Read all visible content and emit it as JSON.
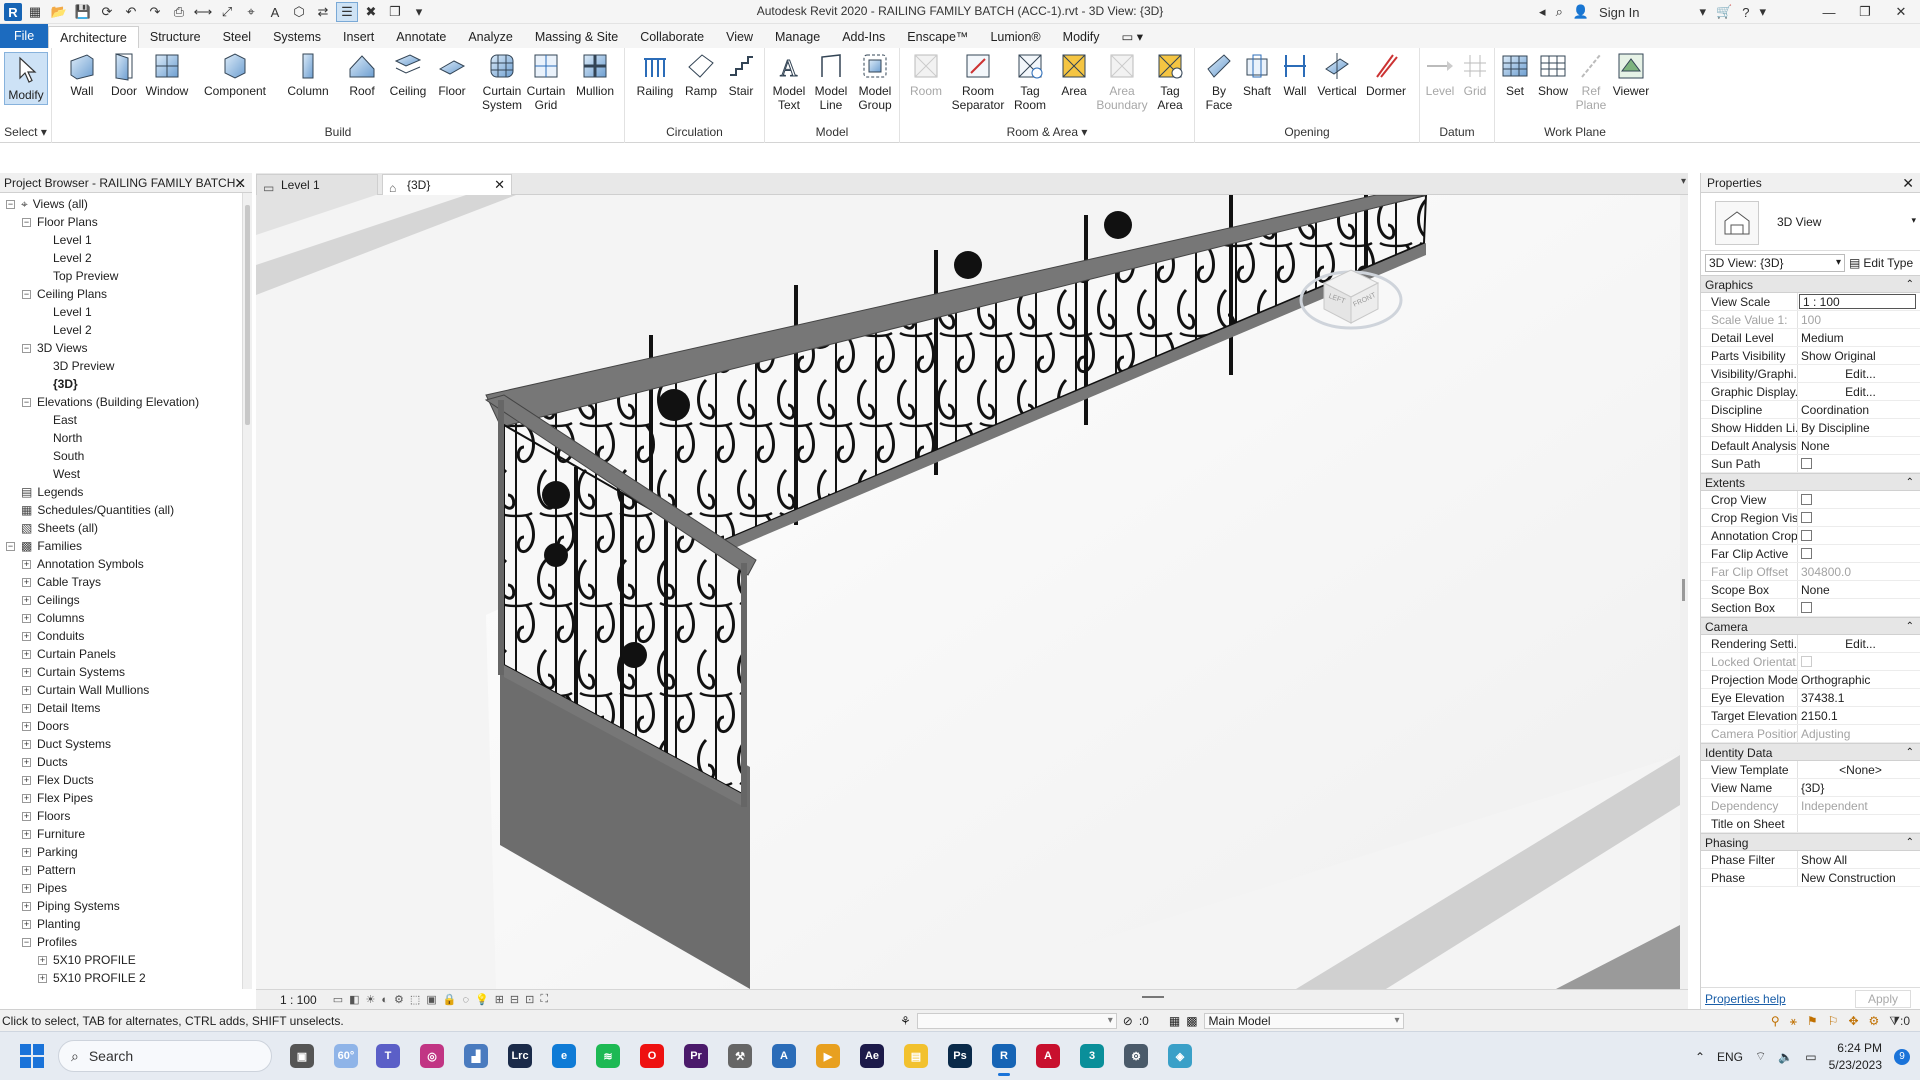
{
  "title_bar": {
    "app_title": "Autodesk Revit 2020 - RAILING FAMILY BATCH (ACC-1).rvt - 3D View: {3D}",
    "sign_in": "Sign In",
    "logo": "R"
  },
  "ribbon_tabs": [
    "File",
    "Architecture",
    "Structure",
    "Steel",
    "Systems",
    "Insert",
    "Annotate",
    "Analyze",
    "Massing & Site",
    "Collaborate",
    "View",
    "Manage",
    "Add-Ins",
    "Enscape™",
    "Lumion®",
    "Modify"
  ],
  "ribbon": {
    "select": {
      "button": "Modify",
      "title": "Select"
    },
    "build": {
      "title": "Build",
      "buttons": [
        "Wall",
        "Door",
        "Window",
        "Component",
        "Column",
        "Roof",
        "Ceiling",
        "Floor",
        "Curtain System",
        "Curtain Grid",
        "Mullion"
      ]
    },
    "circulation": {
      "title": "Circulation",
      "buttons": [
        "Railing",
        "Ramp",
        "Stair"
      ]
    },
    "model": {
      "title": "Model",
      "buttons": [
        "Model Text",
        "Model Line",
        "Model Group"
      ]
    },
    "room_area": {
      "title": "Room & Area",
      "buttons": [
        "Room",
        "Room Separator",
        "Tag Room",
        "Area",
        "Area Boundary",
        "Tag Area"
      ]
    },
    "opening": {
      "title": "Opening",
      "buttons": [
        "By Face",
        "Shaft",
        "Wall",
        "Vertical",
        "Dormer"
      ]
    },
    "datum": {
      "title": "Datum",
      "buttons": [
        "Level",
        "Grid"
      ]
    },
    "work_plane": {
      "title": "Work Plane",
      "buttons": [
        "Set",
        "Show",
        "Ref Plane",
        "Viewer"
      ]
    }
  },
  "project_browser": {
    "title": "Project Browser - RAILING FAMILY BATCH...",
    "rows": [
      {
        "label": "Views (all)",
        "indent": 0,
        "toggle": "−",
        "icon": "views"
      },
      {
        "label": "Floor Plans",
        "indent": 1,
        "toggle": "−"
      },
      {
        "label": "Level 1",
        "indent": 2,
        "toggle": ""
      },
      {
        "label": "Level 2",
        "indent": 2,
        "toggle": ""
      },
      {
        "label": "Top Preview",
        "indent": 2,
        "toggle": ""
      },
      {
        "label": "Ceiling Plans",
        "indent": 1,
        "toggle": "−"
      },
      {
        "label": "Level 1",
        "indent": 2,
        "toggle": ""
      },
      {
        "label": "Level 2",
        "indent": 2,
        "toggle": ""
      },
      {
        "label": "3D Views",
        "indent": 1,
        "toggle": "−"
      },
      {
        "label": "3D Preview",
        "indent": 2,
        "toggle": ""
      },
      {
        "label": "{3D}",
        "indent": 2,
        "toggle": "",
        "bold": true
      },
      {
        "label": "Elevations (Building Elevation)",
        "indent": 1,
        "toggle": "−"
      },
      {
        "label": "East",
        "indent": 2,
        "toggle": ""
      },
      {
        "label": "North",
        "indent": 2,
        "toggle": ""
      },
      {
        "label": "South",
        "indent": 2,
        "toggle": ""
      },
      {
        "label": "West",
        "indent": 2,
        "toggle": ""
      },
      {
        "label": "Legends",
        "indent": 0,
        "toggle": "",
        "icon": "legend"
      },
      {
        "label": "Schedules/Quantities (all)",
        "indent": 0,
        "toggle": "",
        "icon": "schedule"
      },
      {
        "label": "Sheets (all)",
        "indent": 0,
        "toggle": "",
        "icon": "sheet"
      },
      {
        "label": "Families",
        "indent": 0,
        "toggle": "−",
        "icon": "family"
      },
      {
        "label": "Annotation Symbols",
        "indent": 1,
        "toggle": "+"
      },
      {
        "label": "Cable Trays",
        "indent": 1,
        "toggle": "+"
      },
      {
        "label": "Ceilings",
        "indent": 1,
        "toggle": "+"
      },
      {
        "label": "Columns",
        "indent": 1,
        "toggle": "+"
      },
      {
        "label": "Conduits",
        "indent": 1,
        "toggle": "+"
      },
      {
        "label": "Curtain Panels",
        "indent": 1,
        "toggle": "+"
      },
      {
        "label": "Curtain Systems",
        "indent": 1,
        "toggle": "+"
      },
      {
        "label": "Curtain Wall Mullions",
        "indent": 1,
        "toggle": "+"
      },
      {
        "label": "Detail Items",
        "indent": 1,
        "toggle": "+"
      },
      {
        "label": "Doors",
        "indent": 1,
        "toggle": "+"
      },
      {
        "label": "Duct Systems",
        "indent": 1,
        "toggle": "+"
      },
      {
        "label": "Ducts",
        "indent": 1,
        "toggle": "+"
      },
      {
        "label": "Flex Ducts",
        "indent": 1,
        "toggle": "+"
      },
      {
        "label": "Flex Pipes",
        "indent": 1,
        "toggle": "+"
      },
      {
        "label": "Floors",
        "indent": 1,
        "toggle": "+"
      },
      {
        "label": "Furniture",
        "indent": 1,
        "toggle": "+"
      },
      {
        "label": "Parking",
        "indent": 1,
        "toggle": "+"
      },
      {
        "label": "Pattern",
        "indent": 1,
        "toggle": "+"
      },
      {
        "label": "Pipes",
        "indent": 1,
        "toggle": "+"
      },
      {
        "label": "Piping Systems",
        "indent": 1,
        "toggle": "+"
      },
      {
        "label": "Planting",
        "indent": 1,
        "toggle": "+"
      },
      {
        "label": "Profiles",
        "indent": 1,
        "toggle": "−"
      },
      {
        "label": "5X10 PROFILE",
        "indent": 2,
        "toggle": "+"
      },
      {
        "label": "5X10 PROFILE 2",
        "indent": 2,
        "toggle": "+"
      }
    ]
  },
  "doc_tabs": [
    {
      "label": "Level 1",
      "icon": "plan"
    },
    {
      "label": "{3D}",
      "icon": "3d",
      "active": true
    }
  ],
  "view_control": {
    "scale": "1 : 100"
  },
  "properties": {
    "title": "Properties",
    "type_name": "3D View",
    "instance_selector": "3D View: {3D}",
    "edit_type": "Edit Type",
    "groups": [
      {
        "name": "Graphics",
        "rows": [
          {
            "k": "View Scale",
            "v": "1 : 100",
            "style": "boxed"
          },
          {
            "k": "Scale Value    1:",
            "v": "100",
            "dis": true
          },
          {
            "k": "Detail Level",
            "v": "Medium"
          },
          {
            "k": "Parts Visibility",
            "v": "Show Original"
          },
          {
            "k": "Visibility/Graphi...",
            "v": "Edit...",
            "style": "btn"
          },
          {
            "k": "Graphic Display...",
            "v": "Edit...",
            "style": "btn"
          },
          {
            "k": "Discipline",
            "v": "Coordination"
          },
          {
            "k": "Show Hidden Li...",
            "v": "By Discipline"
          },
          {
            "k": "Default Analysis...",
            "v": "None"
          },
          {
            "k": "Sun Path",
            "v": "",
            "check": true
          }
        ]
      },
      {
        "name": "Extents",
        "rows": [
          {
            "k": "Crop View",
            "v": "",
            "check": true
          },
          {
            "k": "Crop Region Vis...",
            "v": "",
            "check": true
          },
          {
            "k": "Annotation Crop",
            "v": "",
            "check": true
          },
          {
            "k": "Far Clip Active",
            "v": "",
            "check": true
          },
          {
            "k": "Far Clip Offset",
            "v": "304800.0",
            "dis": true
          },
          {
            "k": "Scope Box",
            "v": "None"
          },
          {
            "k": "Section Box",
            "v": "",
            "check": true
          }
        ]
      },
      {
        "name": "Camera",
        "rows": [
          {
            "k": "Rendering Setti...",
            "v": "Edit...",
            "style": "btn"
          },
          {
            "k": "Locked Orientat...",
            "v": "",
            "check": true,
            "dis": true
          },
          {
            "k": "Projection Mode",
            "v": "Orthographic"
          },
          {
            "k": "Eye Elevation",
            "v": "37438.1"
          },
          {
            "k": "Target Elevation",
            "v": "2150.1"
          },
          {
            "k": "Camera Position",
            "v": "Adjusting",
            "dis": true
          }
        ]
      },
      {
        "name": "Identity Data",
        "rows": [
          {
            "k": "View Template",
            "v": "<None>",
            "style": "btn"
          },
          {
            "k": "View Name",
            "v": "{3D}"
          },
          {
            "k": "Dependency",
            "v": "Independent",
            "dis": true
          },
          {
            "k": "Title on Sheet",
            "v": ""
          }
        ]
      },
      {
        "name": "Phasing",
        "rows": [
          {
            "k": "Phase Filter",
            "v": "Show All"
          },
          {
            "k": "Phase",
            "v": "New Construction"
          }
        ]
      }
    ],
    "help_link": "Properties help",
    "apply": "Apply"
  },
  "status_bar": {
    "text": "Click to select, TAB for alternates, CTRL adds, SHIFT unselects.",
    "count": ":0",
    "model": "Main Model",
    "filter_count": ":0"
  },
  "taskbar": {
    "search": "Search",
    "weather": "60°",
    "lang": "ENG",
    "time": "6:24 PM",
    "date": "5/23/2023",
    "notifications": "9"
  },
  "viewcube": {
    "left": "LEFT",
    "front": "FRONT"
  }
}
